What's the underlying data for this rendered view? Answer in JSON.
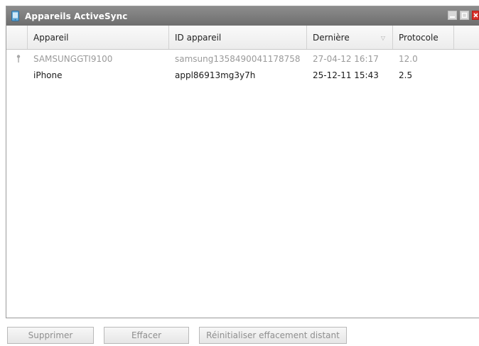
{
  "window": {
    "title": "Appareils ActiveSync"
  },
  "table": {
    "columns": [
      "Appareil",
      "ID appareil",
      "Dernière",
      "Protocole"
    ],
    "rows": [
      {
        "device": "SAMSUNGGTI9100",
        "device_id": "samsung1358490041178758",
        "last": "27-04-12 16:17",
        "protocol": "12.0",
        "marker": "pin-icon"
      },
      {
        "device": "iPhone",
        "device_id": "appl86913mg3y7h",
        "last": "25-12-11 15:43",
        "protocol": "2.5"
      }
    ]
  },
  "buttons": {
    "delete": "Supprimer",
    "wipe": "Effacer",
    "reset_remote_wipe": "Réinitialiser effacement distant"
  },
  "colors": {
    "titlebar": "#7d7d7d",
    "close": "#d9302a"
  }
}
